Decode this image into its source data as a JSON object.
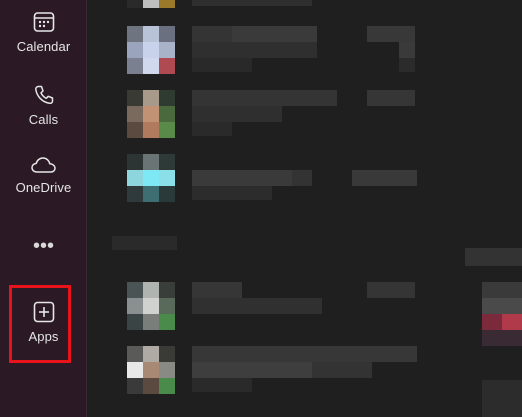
{
  "sidebar": {
    "calendar_label": "Calendar",
    "calls_label": "Calls",
    "onedrive_label": "OneDrive",
    "more_label": "•••",
    "apps_label": "Apps"
  },
  "colors": {
    "rail_background": "#2b1a25",
    "highlight_border": "#e8141a",
    "content_background": "#1f1f1f"
  }
}
